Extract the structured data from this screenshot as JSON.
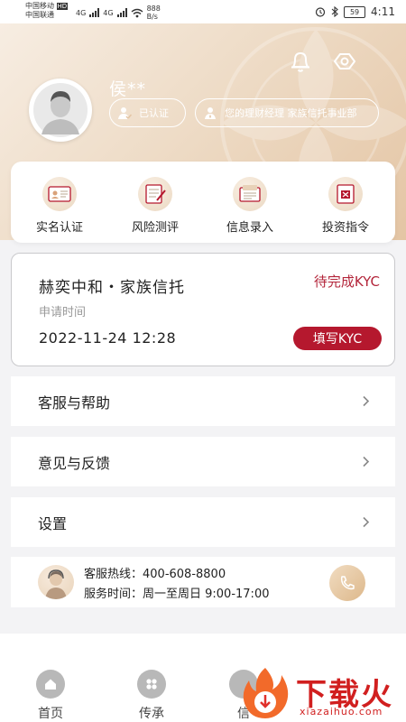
{
  "status_bar": {
    "carrier1": "中国移动",
    "carrier1_tag": "HD",
    "carrier2": "中国联通",
    "net1": "4G",
    "net2": "4G",
    "speed_value": "888",
    "speed_unit": "B/s",
    "battery": "59",
    "time": "4:11"
  },
  "profile": {
    "name": "侯**",
    "verified_label": "已认证",
    "manager_label": "您的理财经理  家族信托事业部"
  },
  "quick_actions": [
    {
      "label": "实名认证",
      "icon": "id-card-icon"
    },
    {
      "label": "风险测评",
      "icon": "risk-form-icon"
    },
    {
      "label": "信息录入",
      "icon": "document-entry-icon"
    },
    {
      "label": "投资指令",
      "icon": "instruction-seal-icon"
    }
  ],
  "kyc_card": {
    "title": "赫奕中和・家族信托",
    "status": "待完成KYC",
    "sub_label": "申请时间",
    "date": "2022-11-24 12:28",
    "button": "填写KYC"
  },
  "menu": [
    {
      "label": "客服与帮助"
    },
    {
      "label": "意见与反馈"
    },
    {
      "label": "设置"
    }
  ],
  "hotline": {
    "phone_line": "客服热线：400-608-8800",
    "hours_line": "服务时间：周一至周日 9:00-17:00"
  },
  "tabs": [
    {
      "label": "首页",
      "icon": "home-icon"
    },
    {
      "label": "传承",
      "icon": "grid-icon"
    },
    {
      "label": "信",
      "icon": "trust-icon"
    }
  ],
  "watermark": {
    "brand": "下载火",
    "domain": "xiazaihuo.com"
  },
  "colors": {
    "accent_red": "#b5182e",
    "gold_header": "#e4c5a4"
  }
}
